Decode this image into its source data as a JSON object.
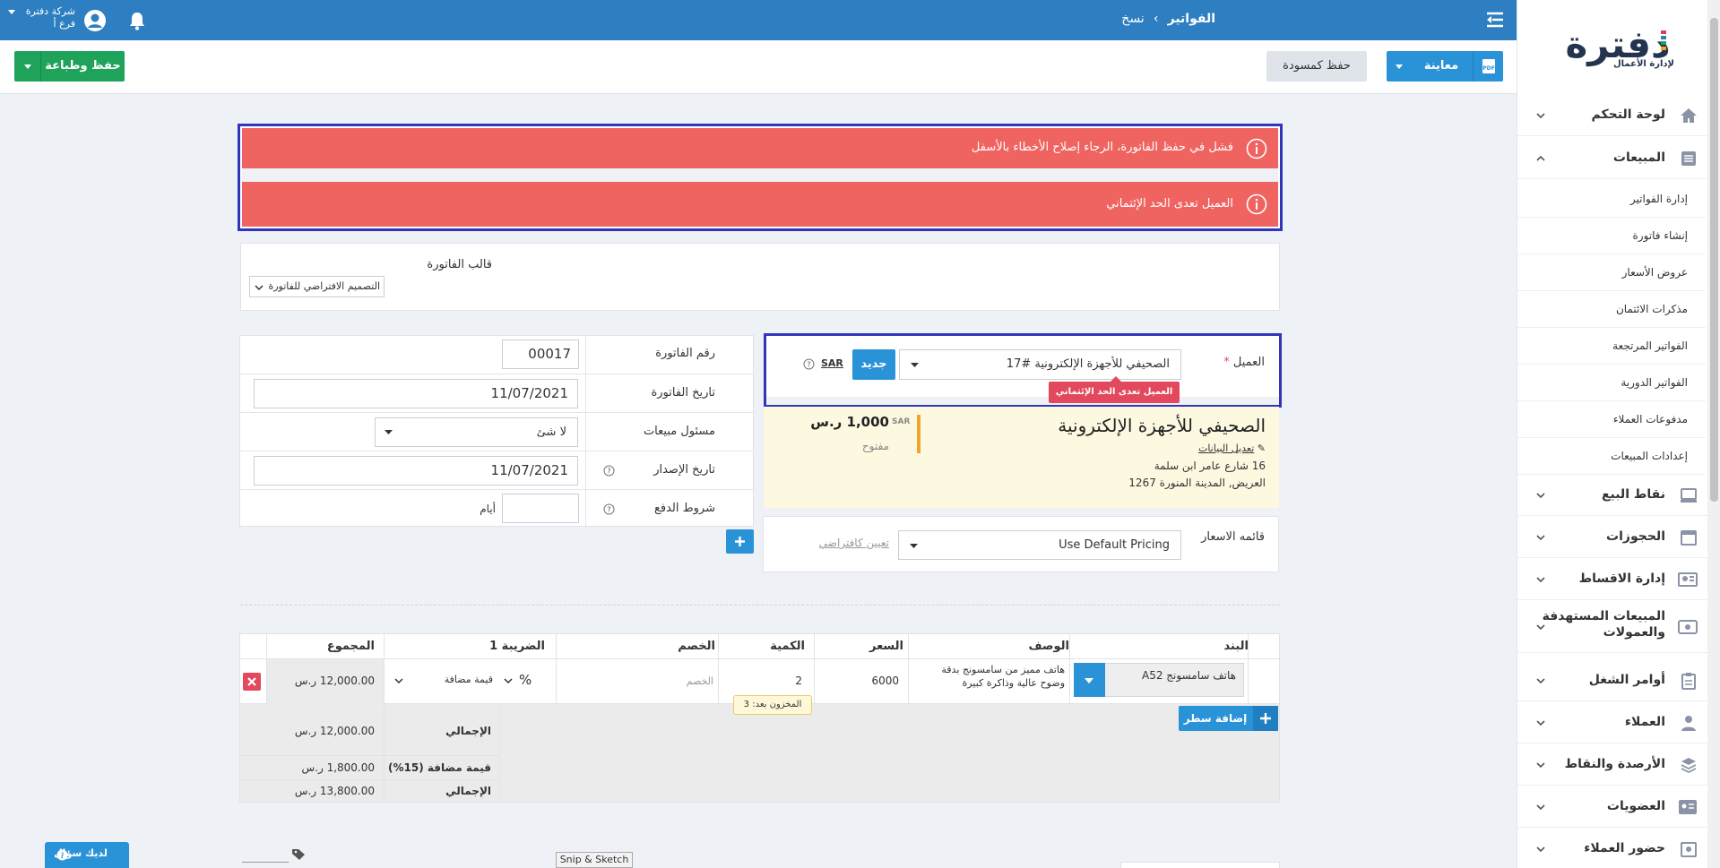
{
  "topbar": {
    "breadcrumb_parent": "الفواتير",
    "breadcrumb_sep": "›",
    "breadcrumb_current": "نسخ",
    "company_name": "شركة دفترة",
    "branch": "فرع أ"
  },
  "actionbar": {
    "save_print": "حفظ وطباعة",
    "save_draft": "حفظ كمسودة",
    "preview": "معاينة"
  },
  "logo": {
    "text": "دفترة",
    "tagline": "لإدارة الأعمال"
  },
  "sidebar": {
    "dashboard": "لوحة التحكم",
    "sales": "المبيعات",
    "sales_sub": [
      "إدارة الفواتير",
      "إنشاء فاتورة",
      "عروض الأسعار",
      "مذكرات الائتمان",
      "الفواتير المرتجعة",
      "الفواتير الدورية",
      "مدفوعات العملاء",
      "إعدادات المبيعات"
    ],
    "items": [
      "نقاط البيع",
      "الحجوزات",
      "إدارة الاقساط",
      "المبيعات المستهدفة",
      "أوامر الشغل",
      "العملاء",
      "الأرصدة والنقاط",
      "العضويات",
      "حضور العملاء"
    ],
    "targets_line1": "المبيعات المستهدفة",
    "targets_line2": "والعمولات"
  },
  "alerts": {
    "save_failed": "فشل في حفظ الفاتورة، الرجاء إصلاح الأخطاء بالأسفل",
    "credit_limit": "العميل تعدى الحد الإئتماني"
  },
  "template": {
    "label": "قالب الفاتورة",
    "value": "التصميم الافتراضي للفاتورة"
  },
  "invoice": {
    "number_label": "رقم الفاتورة",
    "number": "00017",
    "date_label": "تاريخ الفاتورة",
    "date": "11/07/2021",
    "rep_label": "مسئول مبيعات",
    "rep_value": "لا شئ",
    "issue_label": "تاريخ الإصدار",
    "issue_date": "11/07/2021",
    "terms_label": "شروط الدفع",
    "terms_unit": "أيام",
    "help": "?"
  },
  "client": {
    "label": "العميل",
    "required": "*",
    "selected": "الصحيفي للأجهزة الإلكترونية #17",
    "new_button": "جديد",
    "currency": "SAR",
    "tooltip": "العميل تعدى الحد الإئتماني",
    "name": "الصحيفي للأجهزة الإلكترونية",
    "edit": "تعديل البيانات",
    "address1": "16 شارع عامر ابن سلمة",
    "address2": "العريض, المدينة المنورة 1267",
    "balance_currency": "SAR",
    "balance": "1,000 ر.س",
    "status": "مفتوح"
  },
  "pricing": {
    "label": "قائمه الاسعار",
    "value": "Use Default Pricing",
    "set_default": "تعيين كافتراضي"
  },
  "table": {
    "headers": [
      "البند",
      "الوصف",
      "السعر",
      "الكمية",
      "الخصم",
      "الضريبة 1",
      "المجموع"
    ],
    "row": {
      "item": "هاتف سامسونج A52",
      "description_line1": "هاتف مميز من سامسونج بدقة",
      "description_line2": "وضوح عالية وذاكرة كبيرة",
      "price": "6000",
      "qty": "2",
      "discount_placeholder": "الخصم",
      "discount_type": "%",
      "tax": "قيمة مضافة",
      "total": "12,000.00 ر.س"
    },
    "stock_tip": "المخزون بعد: 3",
    "add_row": "إضافة سطر"
  },
  "totals": {
    "subtotal_label": "الإجمالي",
    "subtotal": "12,000.00 ر.س",
    "vat_label": "قيمة مضافة (15%)",
    "vat": "1,800.00 ر.س",
    "total_label": "الإجمالي",
    "total": "13,800.00 ر.س"
  },
  "footer": {
    "help_button": "لديك سؤال",
    "snip": "Snip & Sketch"
  },
  "colors": {
    "topbar": "#2d7fc1",
    "alert": "#ef6461",
    "highlight_border": "#3136b8",
    "green": "#1fa35a",
    "blue": "#2a93d8",
    "tooltip": "#e3495d"
  }
}
